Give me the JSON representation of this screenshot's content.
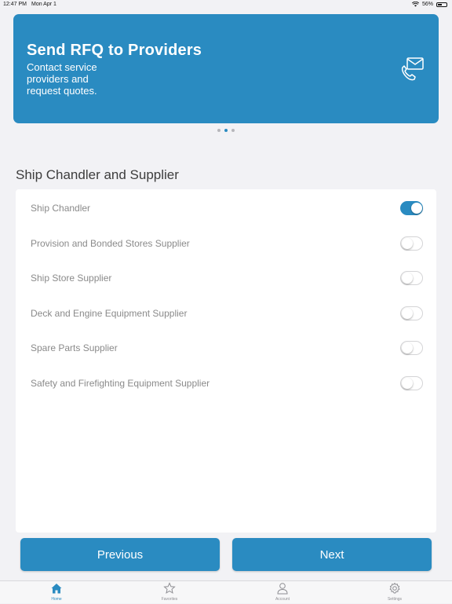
{
  "status_bar": {
    "time": "12:47 PM",
    "date": "Mon Apr 1",
    "battery": "56%"
  },
  "banner": {
    "title": "Send RFQ to Providers",
    "subtitle": "Contact service providers and request quotes."
  },
  "pager": {
    "pages": 3,
    "active_index": 1
  },
  "section": {
    "title": "Ship Chandler and Supplier"
  },
  "suppliers": [
    {
      "label": "Ship Chandler",
      "enabled": true
    },
    {
      "label": "Provision and Bonded Stores Supplier",
      "enabled": false
    },
    {
      "label": "Ship Store Supplier",
      "enabled": false
    },
    {
      "label": "Deck and Engine Equipment Supplier",
      "enabled": false
    },
    {
      "label": "Spare Parts Supplier",
      "enabled": false
    },
    {
      "label": "Safety and Firefighting Equipment Supplier",
      "enabled": false
    }
  ],
  "buttons": {
    "previous": "Previous",
    "next": "Next"
  },
  "tabs": [
    {
      "label": "Home",
      "icon": "home-icon",
      "active": true
    },
    {
      "label": "Favorites",
      "icon": "star-icon",
      "active": false
    },
    {
      "label": "Account",
      "icon": "person-icon",
      "active": false
    },
    {
      "label": "Settings",
      "icon": "gear-icon",
      "active": false
    }
  ],
  "colors": {
    "accent": "#2a8bc1",
    "background": "#f2f2f5",
    "inactive_tab": "#8e8e93"
  }
}
